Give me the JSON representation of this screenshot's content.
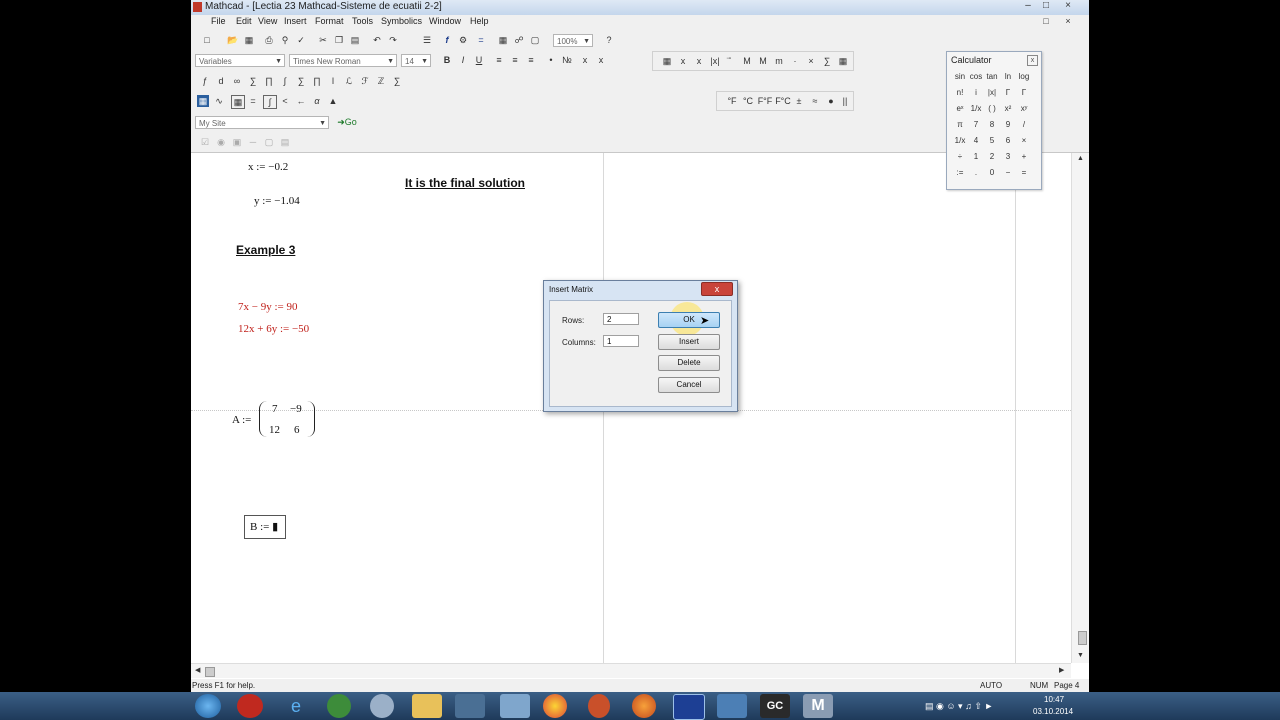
{
  "window": {
    "title": "Mathcad - [Lectia 23 Mathcad-Sisteme de ecuatii 2-2]",
    "controls": [
      "_",
      "□",
      "×"
    ]
  },
  "menu": [
    "File",
    "Edit",
    "View",
    "Insert",
    "Format",
    "Tools",
    "Symbolics",
    "Window",
    "Help"
  ],
  "toolbar": {
    "zoom": "100%",
    "style_combo": "Variables",
    "font_combo": "Times New Roman",
    "size_combo": "14",
    "resources_combo": "My Site",
    "go_label": "Go",
    "format_buttons": [
      "B",
      "I",
      "U"
    ]
  },
  "units_bar": [
    "°F",
    "°C",
    "F°F",
    "F°C",
    "±",
    "≈",
    "●",
    "||"
  ],
  "calculator": {
    "title": "Calculator",
    "keys": [
      "sin",
      "cos",
      "tan",
      "ln",
      "log",
      "n!",
      "i",
      "|x|",
      "Γ",
      "Γ",
      "eˣ",
      "1/x",
      "( )",
      "x²",
      "xʸ",
      "π",
      "7",
      "8",
      "9",
      "/",
      "1/x",
      "4",
      "5",
      "6",
      "×",
      "÷",
      "1",
      "2",
      "3",
      "+",
      ":=",
      ".",
      "0",
      "−",
      "="
    ]
  },
  "worksheet": {
    "x_assign": "x := −0.2",
    "y_assign": "y := −1.04",
    "final_note": "It is the final solution",
    "example_heading": "Example 3",
    "eq1": "7x − 9y := 90",
    "eq2": "12x + 6y := −50",
    "matrix_A_label": "A :=",
    "matrix_A": [
      [
        "7",
        "−9"
      ],
      [
        "12",
        "6"
      ]
    ],
    "matrix_B_label": "B := ▮"
  },
  "dialog": {
    "title": "Insert Matrix",
    "rows_label": "Rows:",
    "rows_value": "2",
    "columns_label": "Columns:",
    "columns_value": "1",
    "ok": "OK",
    "insert": "Insert",
    "delete": "Delete",
    "cancel": "Cancel"
  },
  "status": {
    "help": "Press F1 for help.",
    "mode": "AUTO",
    "num": "NUM",
    "page": "Page 4"
  },
  "clock": {
    "time": "10:47",
    "date": "03.10.2014"
  }
}
